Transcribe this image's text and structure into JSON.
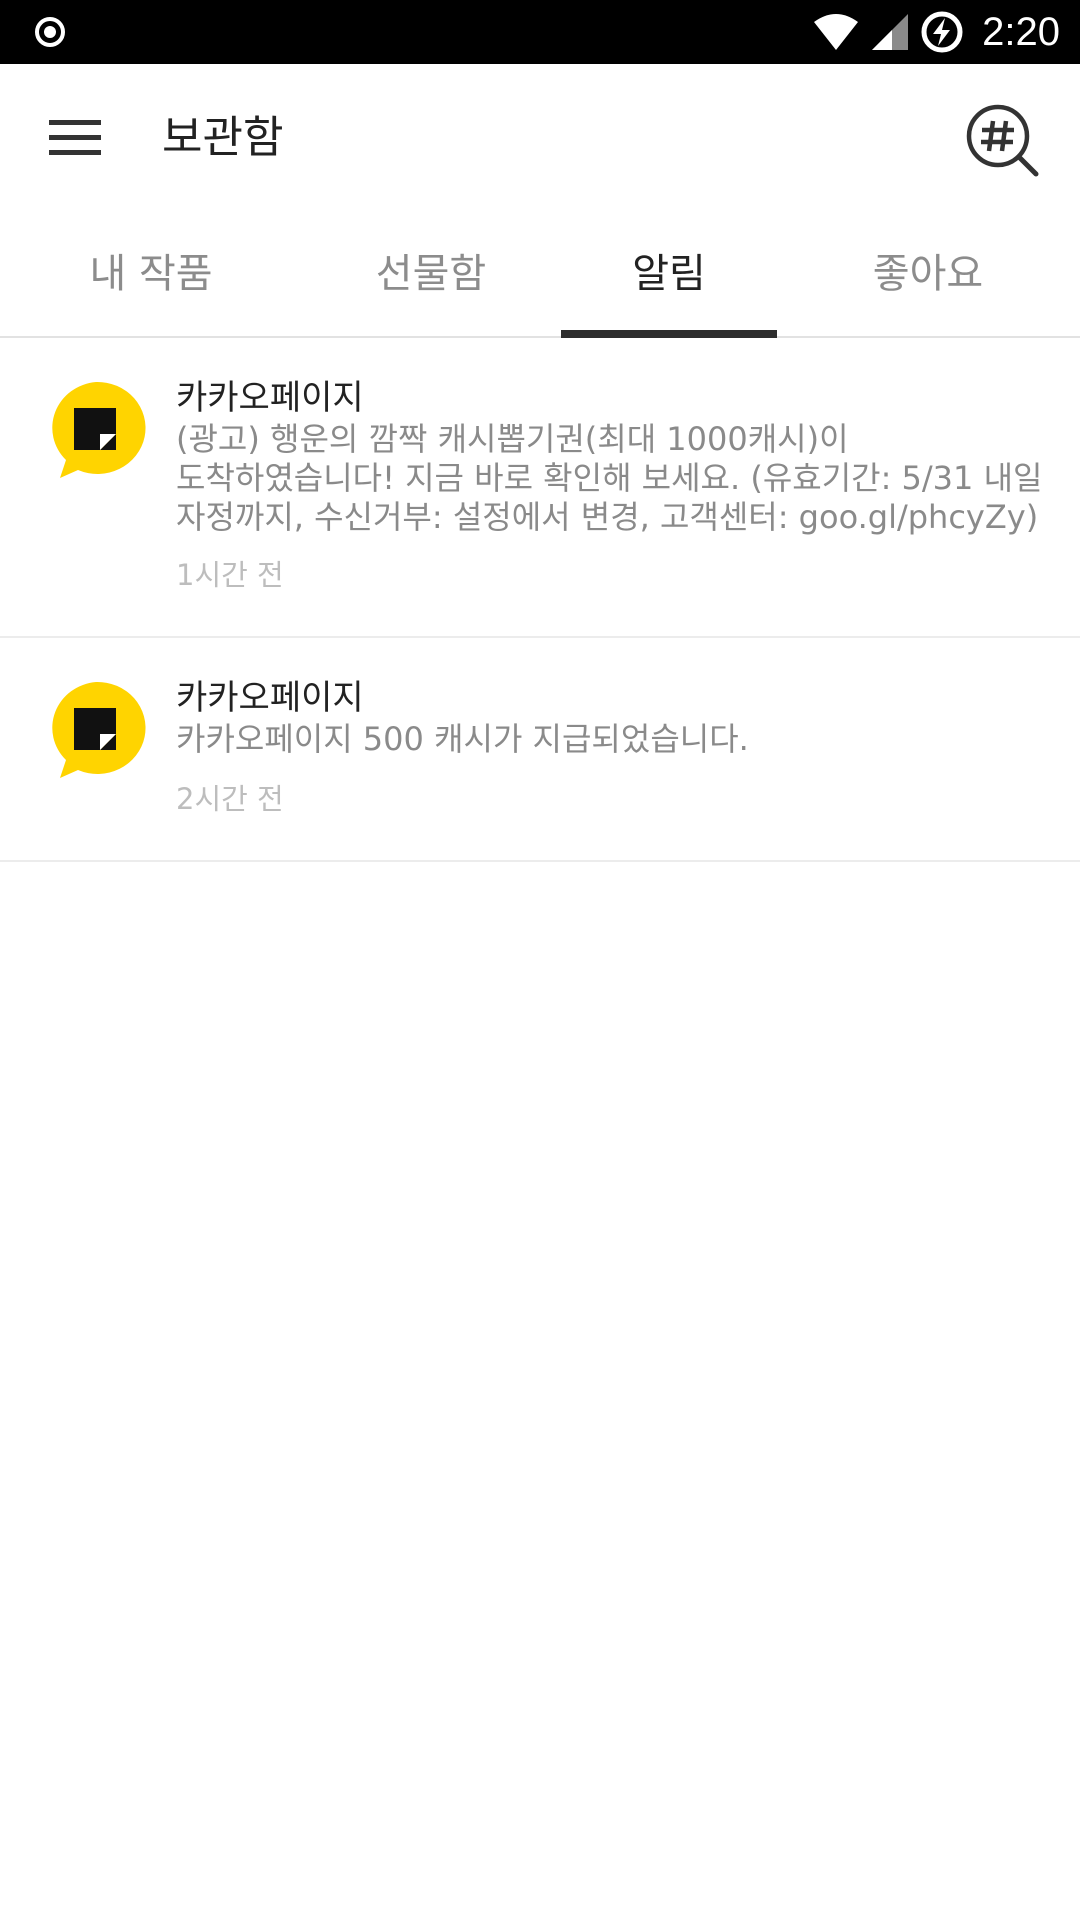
{
  "status_bar": {
    "time": "2:20",
    "icons": [
      "record-icon",
      "wifi-icon",
      "signal-icon",
      "battery-charging-icon"
    ]
  },
  "app_bar": {
    "title": "보관함",
    "menu_icon": "hamburger-menu-icon",
    "search_icon": "hashtag-search-icon"
  },
  "tabs": [
    {
      "label": "내 작품",
      "active": false
    },
    {
      "label": "선물함",
      "active": false
    },
    {
      "label": "알림",
      "active": true
    },
    {
      "label": "좋아요",
      "active": false
    }
  ],
  "notifications": [
    {
      "sender": "카카오페이지",
      "body": "(광고) 행운의 깜짝 캐시뽑기권(최대 1000캐시)이 도착하였습니다! 지금 바로 확인해 보세요. (유효기간: 5/31 내일 자정까지, 수신거부: 설정에서 변경, 고객센터: goo.gl/phcyZy)",
      "time": "1시간 전",
      "icon": "kakaopage-logo-icon"
    },
    {
      "sender": "카카오페이지",
      "body": "카카오페이지 500 캐시가 지급되었습니다.",
      "time": "2시간 전",
      "icon": "kakaopage-logo-icon"
    }
  ],
  "colors": {
    "brand_yellow": "#FFD400",
    "status_bar": "#000000",
    "tab_indicator": "#2D2D2D"
  }
}
